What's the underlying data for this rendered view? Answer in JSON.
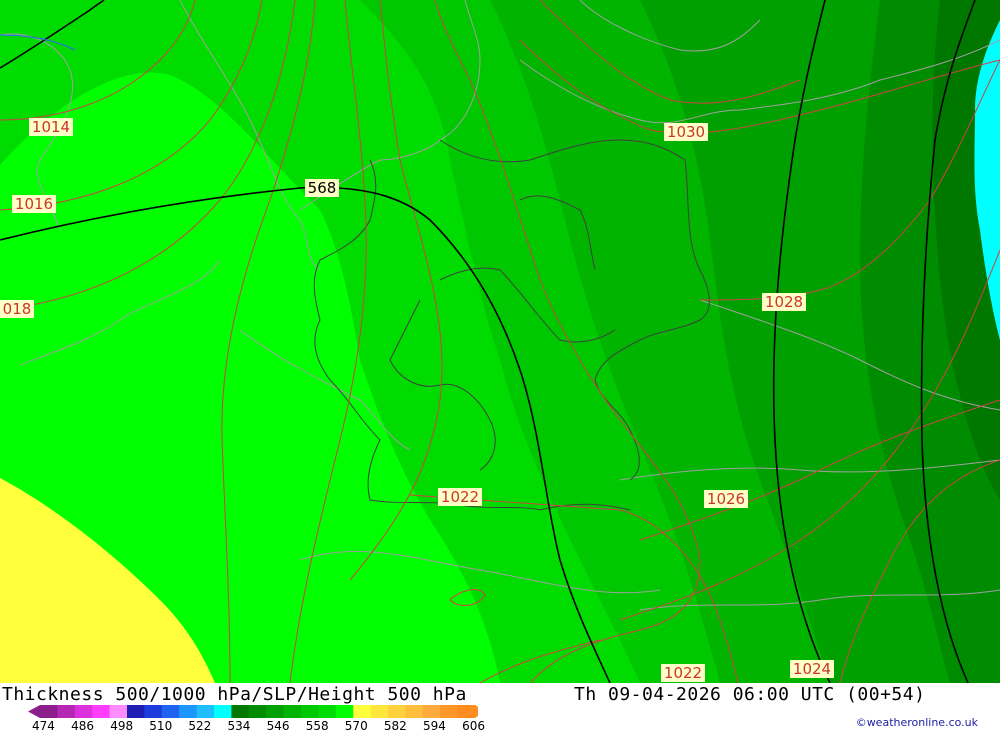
{
  "map": {
    "isobar_labels": [
      {
        "id": "1014",
        "text": "1014"
      },
      {
        "id": "1016",
        "text": "1016"
      },
      {
        "id": "1018",
        "text": "018"
      },
      {
        "id": "1030",
        "text": "1030"
      },
      {
        "id": "1028",
        "text": "1028"
      },
      {
        "id": "1026",
        "text": "1026"
      },
      {
        "id": "1022a",
        "text": "1022"
      },
      {
        "id": "1022b",
        "text": "1022"
      },
      {
        "id": "1024",
        "text": "1024"
      }
    ],
    "height_labels": [
      {
        "id": "568",
        "text": "568"
      }
    ],
    "colors": {
      "zone_yellow": "#ffff3c",
      "zone_lime": "#00ff00",
      "zone_green1": "#00dc00",
      "zone_green2": "#00c800",
      "zone_green3": "#00b400",
      "zone_green4": "#00a000",
      "zone_green5": "#008c00",
      "zone_green6": "#007800",
      "zone_cyan": "#00ffff",
      "isobar": "#cc4444",
      "height_contour": "#000000",
      "border": "#a0a0a0",
      "country_border": "#404040"
    }
  },
  "footer": {
    "title": "Thickness 500/1000 hPa/SLP/Height 500 hPa",
    "datetime": "Th 09-04-2026 06:00 UTC (00+54)",
    "copyright": "©weatheronline.co.uk",
    "legend": {
      "ticks": [
        "474",
        "486",
        "498",
        "510",
        "522",
        "534",
        "546",
        "558",
        "570",
        "582",
        "594",
        "606"
      ],
      "colors": [
        "#8c1e8c",
        "#b428b4",
        "#dc32dc",
        "#ff3cff",
        "#ff8cff",
        "#1e1eb4",
        "#1e3cdc",
        "#1e64f0",
        "#1e96ff",
        "#1ebeff",
        "#00ffff",
        "#007800",
        "#008c00",
        "#00a000",
        "#00b400",
        "#00c800",
        "#00dc00",
        "#00ff00",
        "#ffff3c",
        "#ffe63c",
        "#ffd23c",
        "#ffbe3c",
        "#ffaa3c",
        "#ff9628",
        "#ff8c1e"
      ]
    }
  }
}
